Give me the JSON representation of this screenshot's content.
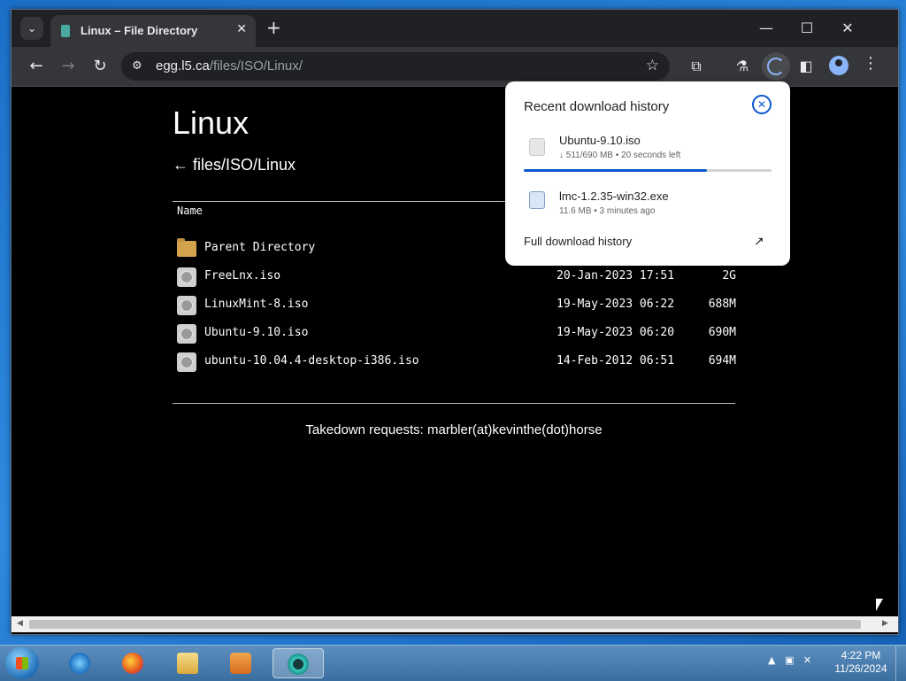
{
  "browser": {
    "tab_title": "Linux – File Directory",
    "tab_close": "✕",
    "new_tab": "+",
    "url_host": "egg.l5.ca",
    "url_path": "/files/ISO/Linux/",
    "controls": {
      "minimize": "—",
      "maximize": "☐",
      "close": "✕"
    }
  },
  "page": {
    "title": "Linux",
    "breadcrumb": "← files/ISO/Linux",
    "column_name": "Name",
    "rows": [
      {
        "name": "Parent Directory",
        "date": "",
        "size": "",
        "icon": "folder-icon"
      },
      {
        "name": "FreeLnx.iso",
        "date": "20-Jan-2023 17:51",
        "size": "2G",
        "icon": "disc-file-icon"
      },
      {
        "name": "LinuxMint-8.iso",
        "date": "19-May-2023 06:22",
        "size": "688M",
        "icon": "disc-file-icon"
      },
      {
        "name": "Ubuntu-9.10.iso",
        "date": "19-May-2023 06:20",
        "size": "690M",
        "icon": "disc-file-icon"
      },
      {
        "name": "ubuntu-10.04.4-desktop-i386.iso",
        "date": "14-Feb-2012 06:51",
        "size": "694M",
        "icon": "disc-file-icon"
      }
    ],
    "footer": "Takedown requests: marbler(at)kevinthe(dot)horse"
  },
  "downloads": {
    "heading": "Recent download history",
    "items": [
      {
        "name": "Ubuntu-9.10.iso",
        "meta": "↓ 511/690 MB • 20 seconds left",
        "progress": 0.74
      },
      {
        "name": "lmc-1.2.35-win32.exe",
        "meta": "11.6 MB • 3 minutes ago"
      }
    ],
    "full_history": "Full download history"
  },
  "taskbar": {
    "time": "4:22 PM",
    "date": "11/26/2024"
  },
  "colors": {
    "accent": "#0b57d0",
    "page_background": "#000000",
    "toolbar": "#35363a"
  }
}
